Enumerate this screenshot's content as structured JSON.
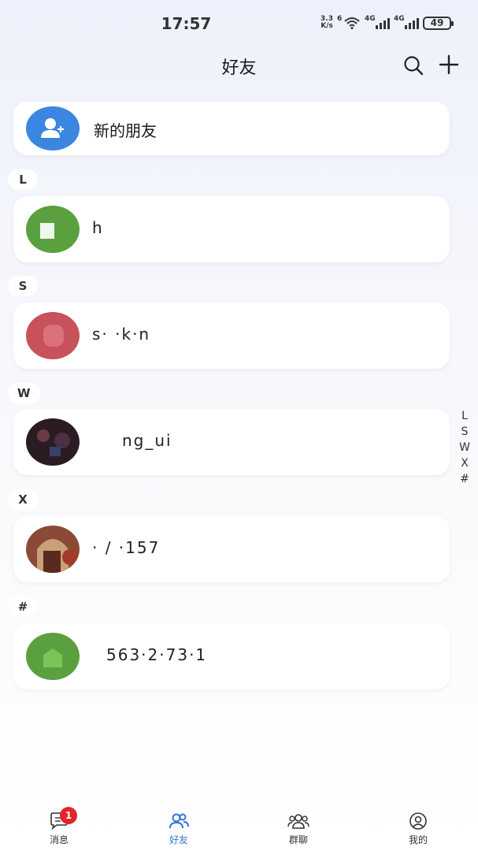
{
  "status_bar": {
    "time": "17:57",
    "net_speed_value": "3.3",
    "net_speed_unit": "K/s",
    "wifi_label": "6",
    "sim1_label": "4G",
    "sim2_label": "4G",
    "battery": "49"
  },
  "header": {
    "title": "好友"
  },
  "new_friend": {
    "label": "新的朋友",
    "icon": "add-user-icon"
  },
  "sections": [
    {
      "letter": "L",
      "contacts": [
        {
          "name": "h",
          "avatar_color": "#5aa03f"
        }
      ]
    },
    {
      "letter": "S",
      "contacts": [
        {
          "name": "s· ·k·n",
          "avatar_color": "#c7525b"
        }
      ]
    },
    {
      "letter": "W",
      "contacts": [
        {
          "name": "ng_ui",
          "avatar_color": "#2a1c22"
        }
      ]
    },
    {
      "letter": "X",
      "contacts": [
        {
          "name": "· / ·157",
          "avatar_color": "#8a4a36"
        }
      ]
    },
    {
      "letter": "#",
      "contacts": [
        {
          "name": "563·2·73·1",
          "avatar_color": "#5aa03f"
        }
      ]
    }
  ],
  "index_letters": [
    "L",
    "S",
    "W",
    "X",
    "#"
  ],
  "tabs": [
    {
      "label": "消息",
      "badge": "1",
      "icon": "message-icon"
    },
    {
      "label": "好友",
      "active": true,
      "icon": "friends-icon"
    },
    {
      "label": "群聊",
      "icon": "group-chat-icon"
    },
    {
      "label": "我的",
      "icon": "profile-icon"
    }
  ],
  "colors": {
    "accent": "#2f74d8",
    "badge": "#e0252b"
  }
}
